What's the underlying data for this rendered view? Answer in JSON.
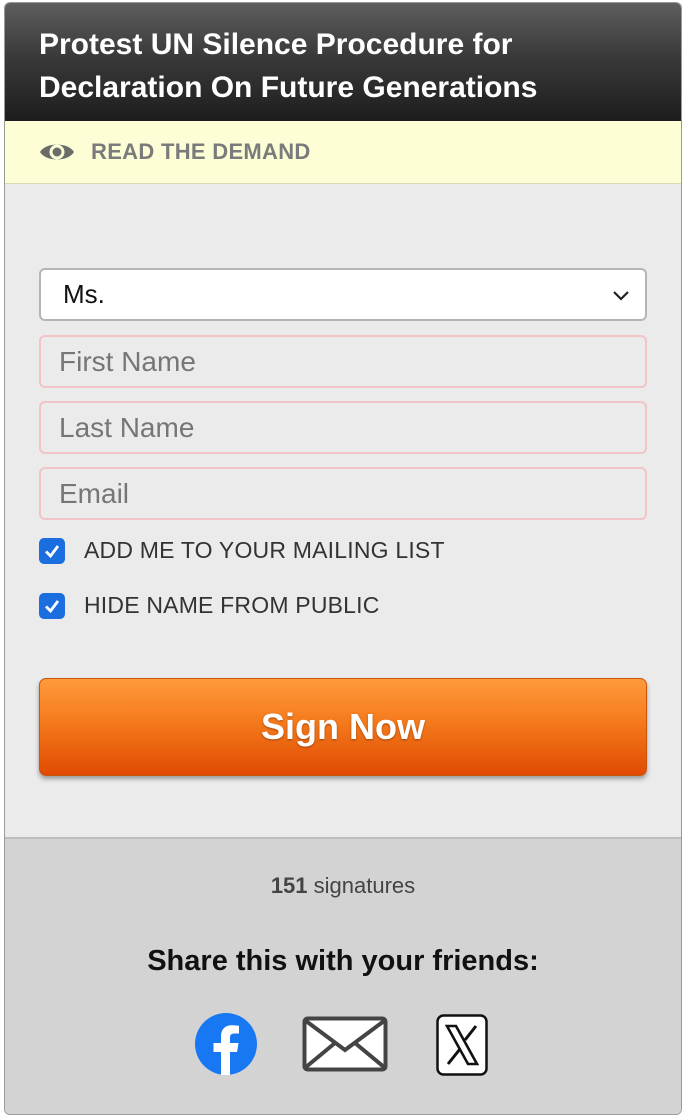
{
  "header": {
    "title": "Protest UN Silence Procedure for Declaration On Future Generations"
  },
  "demand": {
    "label": "READ THE DEMAND",
    "icon": "eye-icon"
  },
  "form": {
    "salutation": {
      "selected": "Ms."
    },
    "first_name": {
      "placeholder": "First Name",
      "value": ""
    },
    "last_name": {
      "placeholder": "Last Name",
      "value": ""
    },
    "email": {
      "placeholder": "Email",
      "value": ""
    },
    "checkboxes": [
      {
        "label": "ADD ME TO YOUR MAILING LIST",
        "checked": true
      },
      {
        "label": "HIDE NAME FROM PUBLIC",
        "checked": true
      }
    ],
    "submit_label": "Sign Now"
  },
  "footer": {
    "signature_count": "151",
    "signature_label": "signatures",
    "share_heading": "Share this with your friends:",
    "share_icons": [
      "facebook-icon",
      "email-icon",
      "x-icon"
    ]
  },
  "colors": {
    "button": "#f26c12",
    "checkbox": "#1a6ee0",
    "demand_bg": "#fdfed6",
    "facebook": "#1877f2"
  }
}
